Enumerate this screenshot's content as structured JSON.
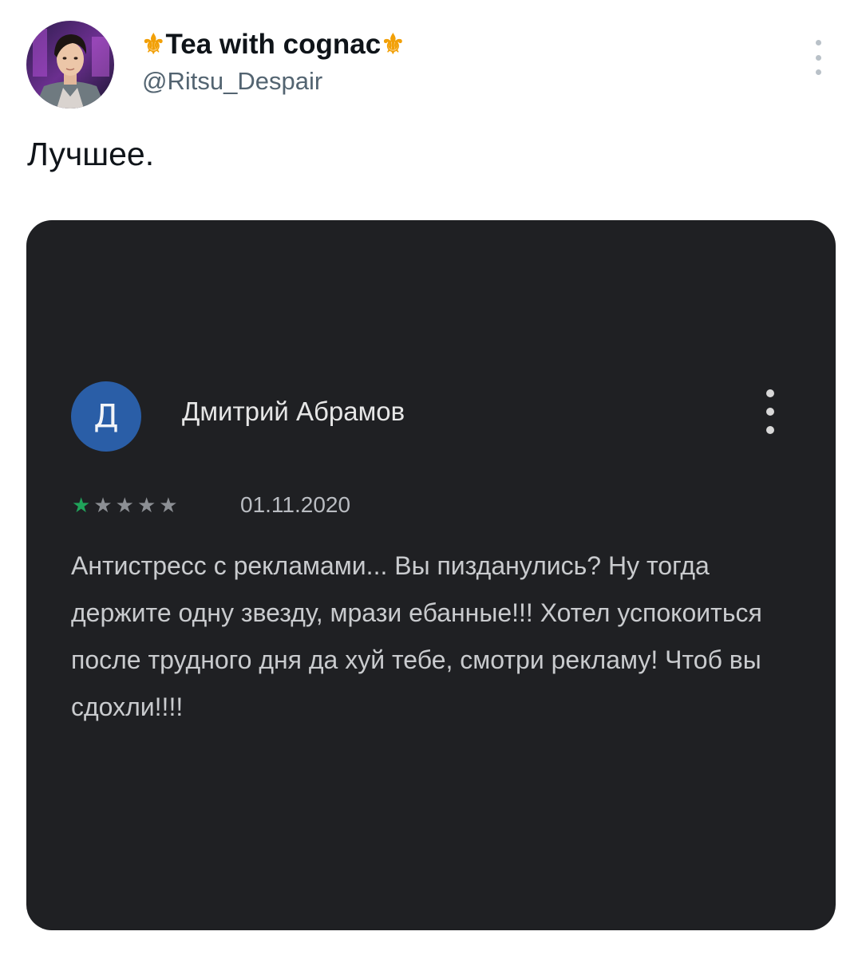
{
  "tweet": {
    "display_name": "Tea with cognac",
    "name_emoji": "⚜",
    "handle": "@Ritsu_Despair",
    "text": "Лучшее.",
    "more_icon": "more-vertical-icon"
  },
  "review": {
    "avatar_letter": "Д",
    "avatar_color": "#2a5ea7",
    "author": "Дмитрий Абрамов",
    "rating": 1,
    "rating_max": 5,
    "star_color": "#20a35a",
    "date": "01.11.2020",
    "text": "Антистресс с рекламами... Вы пизданулись? Ну тогда держите одну звезду, мрази ебанные!!! Хотел успокоиться после трудного дня да хуй тебе, смотри рекламу! Чтоб вы сдохли!!!!",
    "more_icon": "more-vertical-icon"
  },
  "colors": {
    "background": "#ffffff",
    "text_primary": "#0f1419",
    "text_secondary": "#536471",
    "media_background": "#1f2023",
    "emoji_gold": "#f2a007"
  }
}
